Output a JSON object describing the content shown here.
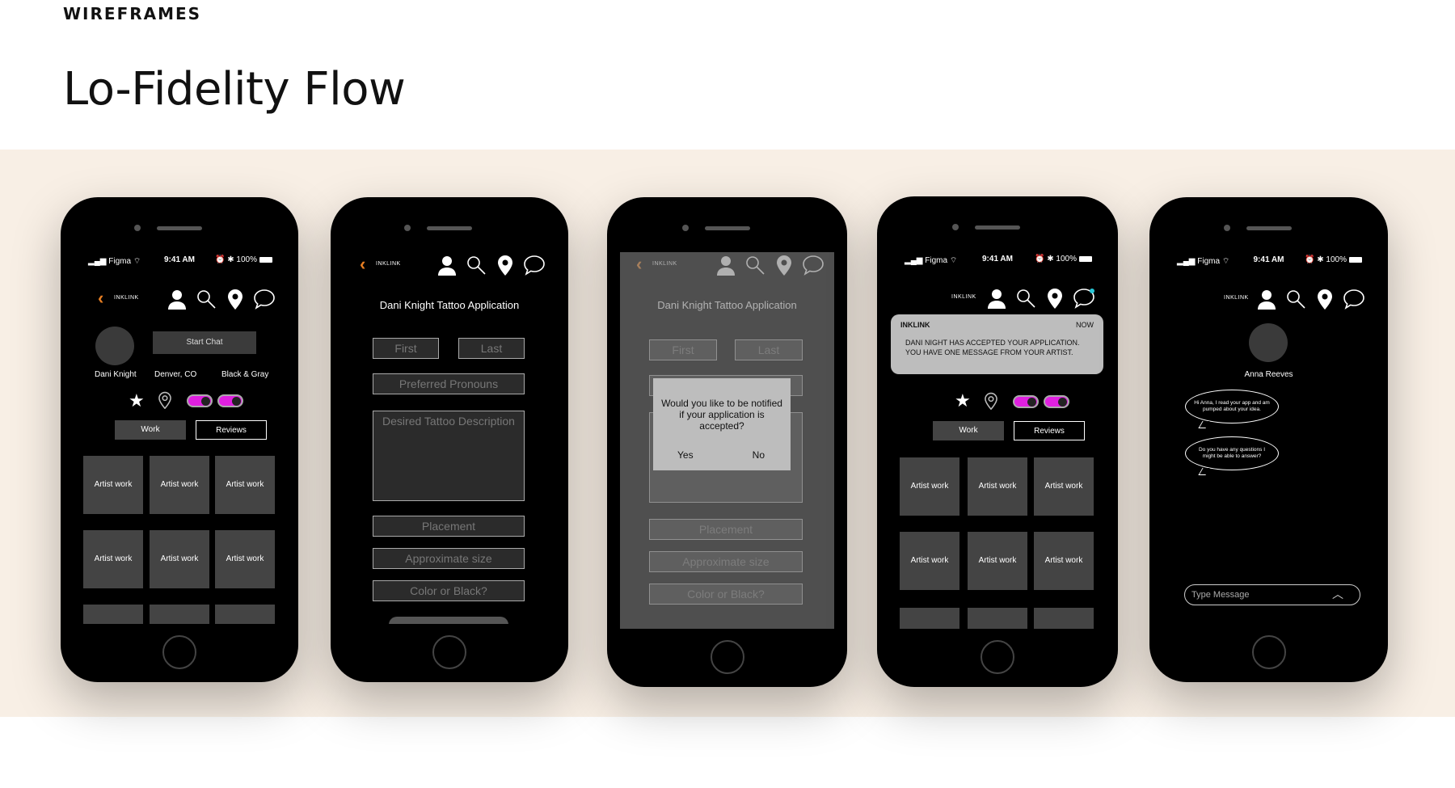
{
  "header": {
    "eyebrow": "WIREFRAMES",
    "title": "Lo-Fidelity Flow"
  },
  "status": {
    "carrier": "Figma",
    "time": "9:41 AM",
    "battery": "100%"
  },
  "nav": {
    "brand": "INKLINK",
    "back_icon": "chevron-left-icon",
    "icons": [
      "user-icon",
      "search-icon",
      "location-pin-icon",
      "chat-bubble-icon"
    ]
  },
  "profile": {
    "artist_name": "Dani Knight",
    "location": "Denver, CO",
    "style": "Black & Gray",
    "start_chat": "Start Chat",
    "tab_work": "Work",
    "tab_reviews": "Reviews",
    "tiles": [
      "Artist work",
      "Artist work",
      "Artist work",
      "Artist work",
      "Artist work",
      "Artist work"
    ]
  },
  "application": {
    "title": "Dani Knight Tattoo Application",
    "first": "First",
    "last": "Last",
    "pronouns": "Preferred Pronouns",
    "description": "Desired Tattoo Description",
    "placement": "Placement",
    "size": "Approximate size",
    "color": "Color or Black?"
  },
  "dialog": {
    "question": "Would you like to be notified if your application is accepted?",
    "yes": "Yes",
    "no": "No"
  },
  "notification": {
    "app": "INKLINK",
    "when": "NOW",
    "line1": "DANI NIGHT HAS ACCEPTED YOUR APPLICATION.",
    "line2": "YOU HAVE ONE MESSAGE FROM YOUR ARTIST."
  },
  "chat": {
    "name": "Anna Reeves",
    "msg1": "Hi Anna, I read your app and am pumped about your idea.",
    "msg2": "Do you have any questions I might be able to answer?",
    "placeholder": "Type Message"
  },
  "colors": {
    "accent_orange": "#e67e22",
    "toggle_magenta": "#e020e0",
    "band": "#f8efe5"
  }
}
